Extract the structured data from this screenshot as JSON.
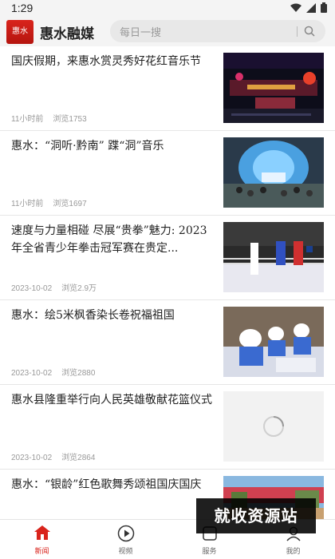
{
  "status_bar": {
    "time": "1:29"
  },
  "header": {
    "logo_text": "惠水",
    "app_title": "惠水融媒",
    "search_placeholder": "每日一搜"
  },
  "feed": [
    {
      "title": "国庆假期，来惠水赏灵秀好花红音乐节",
      "time": "11小时前",
      "views": "浏览1753",
      "thumb": "stage-concert"
    },
    {
      "title": "惠水：“洞听·黔南” 蹀“洞”音乐",
      "time": "11小时前",
      "views": "浏览1697",
      "thumb": "cave-concert"
    },
    {
      "title": "速度与力量相碰 尽展“贵拳”魅力: 2023年全省青少年拳击冠军赛在贵定...",
      "time": "2023-10-02",
      "views": "浏览2.9万",
      "thumb": "boxing"
    },
    {
      "title": "惠水：绘5米枫香染长卷祝福祖国",
      "time": "2023-10-02",
      "views": "浏览2880",
      "thumb": "painting"
    },
    {
      "title": "惠水县隆重举行向人民英雄敬献花篮仪式",
      "time": "2023-10-02",
      "views": "浏览2864",
      "thumb": "loading"
    },
    {
      "title": "惠水：“银龄”红色歌舞秀颂祖国庆国庆",
      "time": "",
      "views": "",
      "thumb": "dance"
    }
  ],
  "bottom_nav": [
    {
      "label": "新闻",
      "icon": "home-icon",
      "active": true
    },
    {
      "label": "视频",
      "icon": "play-icon",
      "active": false
    },
    {
      "label": "服务",
      "icon": "service-icon",
      "active": false
    },
    {
      "label": "我的",
      "icon": "profile-icon",
      "active": false
    }
  ],
  "watermark": "就收资源站",
  "colors": {
    "brand_red": "#d9241c"
  }
}
